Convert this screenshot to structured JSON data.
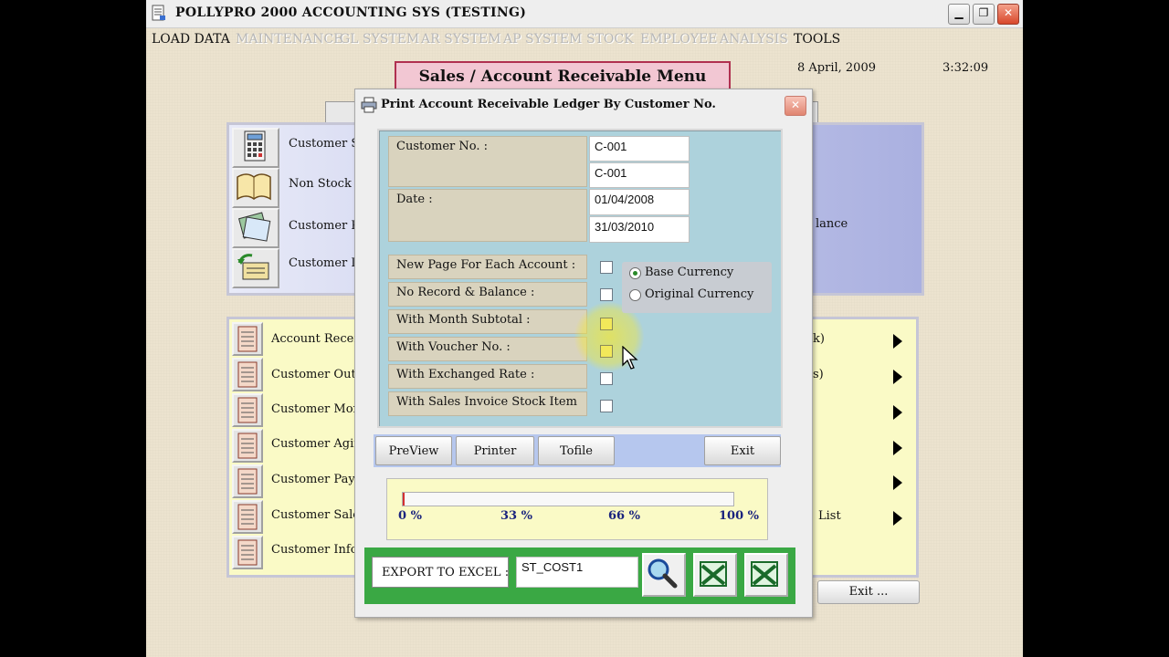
{
  "window": {
    "title": "POLLYPRO 2000 ACCOUNTING SYS (TESTING)",
    "controls": {
      "minimize": "▁",
      "restore": "❐",
      "close": "✕"
    }
  },
  "menubar": [
    {
      "label": "LOAD DATA",
      "enabled": true
    },
    {
      "label": "MAINTENANCE",
      "enabled": false
    },
    {
      "label": "GL SYSTEM",
      "enabled": false
    },
    {
      "label": "AR SYSTEM",
      "enabled": false
    },
    {
      "label": "AP SYSTEM",
      "enabled": false
    },
    {
      "label": "STOCK",
      "enabled": false
    },
    {
      "label": "EMPLOYEE",
      "enabled": false
    },
    {
      "label": "ANALYSIS",
      "enabled": false
    },
    {
      "label": "TOOLS",
      "enabled": true
    }
  ],
  "header": {
    "menu_title": "Sales / Account Receivable Menu",
    "date": "8 April, 2009",
    "time": "3:32:09"
  },
  "panel_top": {
    "items": [
      {
        "label": "Customer Sa",
        "icon": "calculator-icon"
      },
      {
        "label": "Non Stock A",
        "icon": "book-icon"
      },
      {
        "label": "Customer Pe",
        "icon": "payment-icon"
      },
      {
        "label": "Customer De",
        "icon": "deposit-icon"
      }
    ],
    "right_label": "lance"
  },
  "panel_bottom": {
    "items": [
      {
        "label": "Account Receiv"
      },
      {
        "label": "Customer Outst"
      },
      {
        "label": "Customer Mont"
      },
      {
        "label": "Customer Agin"
      },
      {
        "label": "Customer Paym"
      },
      {
        "label": "Customer Sales"
      },
      {
        "label": "Customer Infor"
      }
    ],
    "right_labels": [
      "k)",
      "s)",
      "",
      "",
      "",
      "List",
      ""
    ],
    "exit_label": "Exit ..."
  },
  "dialog": {
    "title": "Print Account Receivable Ledger By Customer No.",
    "close": "✕",
    "customer_label": "Customer No. :",
    "customer_from": "C-001",
    "customer_to": "C-001",
    "date_label": "Date :",
    "date_from": "01/04/2008",
    "date_to": "31/03/2010",
    "options": [
      {
        "label": "New Page For Each Account :",
        "checked": false
      },
      {
        "label": "No Record & Balance :",
        "checked": false
      },
      {
        "label": "With Month Subtotal :",
        "checked": false
      },
      {
        "label": "With Voucher No. :",
        "checked": false
      },
      {
        "label": "With Exchanged Rate :",
        "checked": false
      },
      {
        "label": "With Sales Invoice Stock Item",
        "checked": false
      }
    ],
    "currency": {
      "base": "Base Currency",
      "original": "Original Currency",
      "selected": "base"
    },
    "buttons": {
      "preview": "PreView",
      "printer": "Printer",
      "tofile": "Tofile",
      "exit": "Exit"
    },
    "progress": {
      "value": 0,
      "ticks": [
        "0 %",
        "33 %",
        "66 %",
        "100 %"
      ]
    },
    "export": {
      "label": "EXPORT TO EXCEL :",
      "value": "ST_COST1"
    }
  },
  "colors": {
    "background": "#ece3cf",
    "dialog_criteria": "#add2dc",
    "export_bar": "#3aa844",
    "menu_title_bg": "#f2c7d3",
    "progress_marker": "#d33030"
  }
}
